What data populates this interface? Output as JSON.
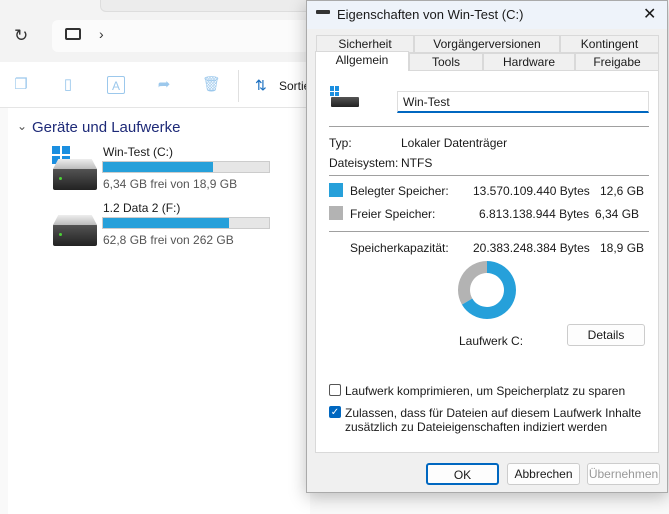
{
  "explorer": {
    "sort_label": "Sortie",
    "section_title": "Geräte und Laufwerke",
    "drives": [
      {
        "name": "Win-Test (C:)",
        "free_text": "6,34 GB frei von 18,9 GB",
        "used_fraction": 0.665
      },
      {
        "name": "1.2 Data 2 (F:)",
        "free_text": "62,8 GB frei von 262 GB",
        "used_fraction": 0.76
      }
    ]
  },
  "dialog": {
    "title": "Eigenschaften von Win-Test (C:)",
    "tabs_row1": [
      "Sicherheit",
      "Vorgängerversionen",
      "Kontingent"
    ],
    "tabs_row2": [
      "Allgemein",
      "Tools",
      "Hardware",
      "Freigabe"
    ],
    "active_tab": "Allgemein",
    "name_value": "Win-Test",
    "type_label": "Typ:",
    "type_value": "Lokaler Datenträger",
    "fs_label": "Dateisystem:",
    "fs_value": "NTFS",
    "used_label": "Belegter Speicher:",
    "used_bytes": "13.570.109.440 Bytes",
    "used_gb": "12,6 GB",
    "free_label": "Freier Speicher:",
    "free_bytes": "6.813.138.944 Bytes",
    "free_gb": "6,34 GB",
    "cap_label": "Speicherkapazität:",
    "cap_bytes": "20.383.248.384 Bytes",
    "cap_gb": "18,9 GB",
    "used_fraction": 0.666,
    "colors": {
      "used": "#26a0da",
      "free": "#b3b3b3"
    },
    "drive_label": "Laufwerk C:",
    "details_button": "Details",
    "compress_label": "Laufwerk komprimieren, um Speicherplatz zu sparen",
    "compress_checked": false,
    "index_label_1": "Zulassen, dass für Dateien auf diesem Laufwerk Inhalte",
    "index_label_2": "zusätzlich zu Dateieigenschaften indiziert werden",
    "index_checked": true,
    "ok": "OK",
    "cancel": "Abbrechen",
    "apply": "Übernehmen"
  }
}
